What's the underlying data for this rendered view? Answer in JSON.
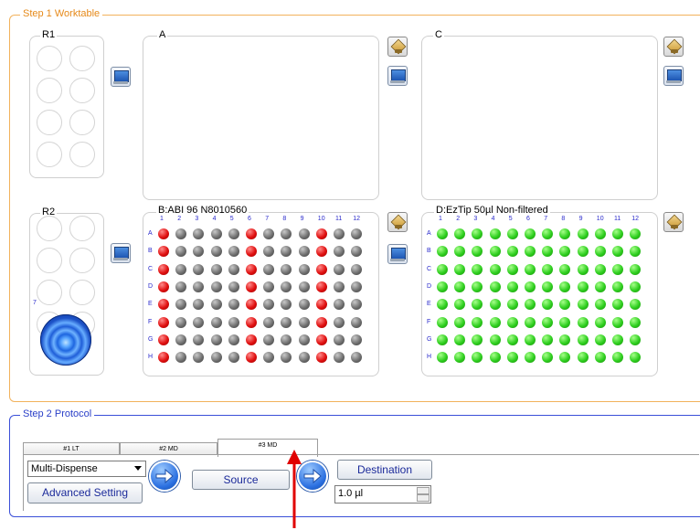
{
  "step1": {
    "legend": "Step 1 Worktable",
    "panels": {
      "r1": "R1",
      "r2": "R2",
      "a": "A",
      "c": "C",
      "b": "B:ABI 96 N8010560",
      "d": "D:EzTip 50µl Non-filtered"
    },
    "r2_count": "7",
    "plate_columns": [
      "1",
      "2",
      "3",
      "4",
      "5",
      "6",
      "7",
      "8",
      "9",
      "10",
      "11",
      "12"
    ],
    "plate_rows": [
      "A",
      "B",
      "C",
      "D",
      "E",
      "F",
      "G",
      "H"
    ],
    "plate_b_red_wells": [
      [
        1,
        6,
        10
      ],
      [
        1,
        6,
        10
      ],
      [
        1,
        6,
        10
      ],
      [
        1,
        6,
        10
      ],
      [
        1,
        6,
        10
      ],
      [
        1,
        6,
        10
      ],
      [
        1,
        6,
        10
      ],
      [
        1,
        6,
        10
      ]
    ],
    "plate_b_pattern": "red=filled, grey=empty",
    "plate_d_color": "green"
  },
  "step2": {
    "legend": "Step 2 Protocol",
    "tabs": [
      {
        "label": "#1 LT"
      },
      {
        "label": "#2 MD"
      },
      {
        "label": "#3 MD",
        "active": true
      }
    ],
    "mode_select": "Multi-Dispense",
    "advanced_setting": "Advanced Setting",
    "source_button": "Source",
    "destination_button": "Destination",
    "volume_value": "1.0 µl"
  },
  "colors": {
    "step1_border": "#f2b25c",
    "step2_border": "#3a4fd8",
    "annotation_arrow": "#e00000"
  }
}
